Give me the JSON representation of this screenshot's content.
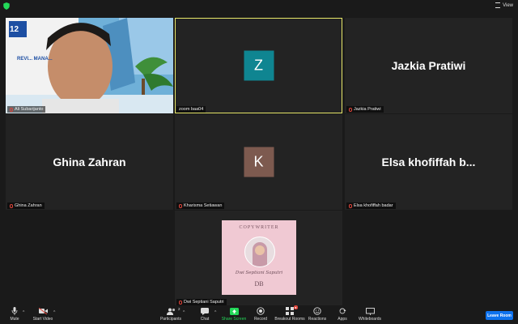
{
  "topbar": {
    "view_label": "View"
  },
  "tiles": [
    {
      "name": "Ali Subarijanto",
      "kind": "video",
      "overlay_text": "REVI... MANA..."
    },
    {
      "name": "zoom baa04",
      "kind": "avatar",
      "initial": "Z",
      "avatar_color": "#0f8591",
      "active": true
    },
    {
      "name": "Jazkia Pratiwi",
      "kind": "text",
      "big_name": "Jazkia Pratiwi"
    },
    {
      "name": "Ghina Zahran",
      "kind": "text",
      "big_name": "Ghina Zahran"
    },
    {
      "name": "Kharisma Setiawan",
      "kind": "avatar",
      "initial": "K",
      "avatar_color": "#7d5a4f"
    },
    {
      "name": "Elsa khofiffah badar",
      "kind": "text",
      "big_name": "Elsa  khofiffah  b..."
    },
    {
      "name": "Dwi Septiani Saputri",
      "kind": "image",
      "card_title": "COPYWRITER",
      "signature": "Dwi Septiani Saputri",
      "monogram": "DB"
    }
  ],
  "toolbar": {
    "mute": "Mute",
    "start_video": "Start Video",
    "participants": "Participants",
    "participants_count": "2",
    "chat": "Chat",
    "share_screen": "Share Screen",
    "record": "Record",
    "breakout_rooms": "Breakout Rooms",
    "reactions": "Reactions",
    "apps": "Apps",
    "whiteboards": "Whiteboards",
    "leave": "Leave Room"
  },
  "colors": {
    "share_green": "#23d959",
    "leave_blue": "#0e72ed",
    "active_border": "#e8e86a",
    "muted_red": "#e0443a"
  }
}
